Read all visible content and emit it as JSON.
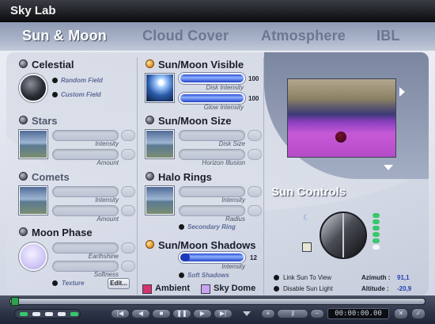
{
  "window": {
    "title": "Sky Lab"
  },
  "tabs": [
    {
      "label": "Sun & Moon"
    },
    {
      "label": "Cloud Cover"
    },
    {
      "label": "Atmosphere"
    },
    {
      "label": "IBL"
    }
  ],
  "left": {
    "celestial": {
      "title": "Celestial",
      "random_field": "Random Field",
      "custom_field": "Custom Field"
    },
    "stars": {
      "title": "Stars",
      "intensity": "Intensity",
      "amount": "Amount"
    },
    "comets": {
      "title": "Comets",
      "intensity": "Intensity",
      "amount": "Amount"
    },
    "moon_phase": {
      "title": "Moon Phase",
      "earthshine": "Earthshine",
      "softness": "Softness",
      "texture": "Texture",
      "edit": "Edit..."
    }
  },
  "middle": {
    "visible": {
      "title": "Sun/Moon Visible",
      "disk_intensity": "Disk Intensity",
      "glow_intensity": "Glow Intensity",
      "disk_value": "100",
      "glow_value": "100"
    },
    "size": {
      "title": "Sun/Moon Size",
      "disk_size": "Disk Size",
      "horizon": "Horizon Illusion"
    },
    "halo": {
      "title": "Halo Rings",
      "intensity": "Intensity",
      "radius": "Radius",
      "secondary": "Secondary Ring"
    },
    "shadows": {
      "title": "Sun/Moon Shadows",
      "intensity": "Intensity",
      "value": "12",
      "soft": "Soft Shadows"
    },
    "ambient": "Ambient",
    "sky_dome": "Sky Dome"
  },
  "right": {
    "sun_controls": "Sun Controls",
    "link_sun": "Link Sun To View",
    "disable_sun": "Disable Sun Light",
    "azimuth_label": "Azimuth :",
    "azimuth_value": "91,1",
    "altitude_label": "Altitude :",
    "altitude_value": "-20,9"
  },
  "timeline": {
    "time": "00:00:00.00"
  },
  "colors": {
    "ambient_swatch": "#d6336d",
    "sky_dome_swatch": "#c9a4f0",
    "accent_blue": "#2b4fd6",
    "led_on": "#e38a17"
  }
}
